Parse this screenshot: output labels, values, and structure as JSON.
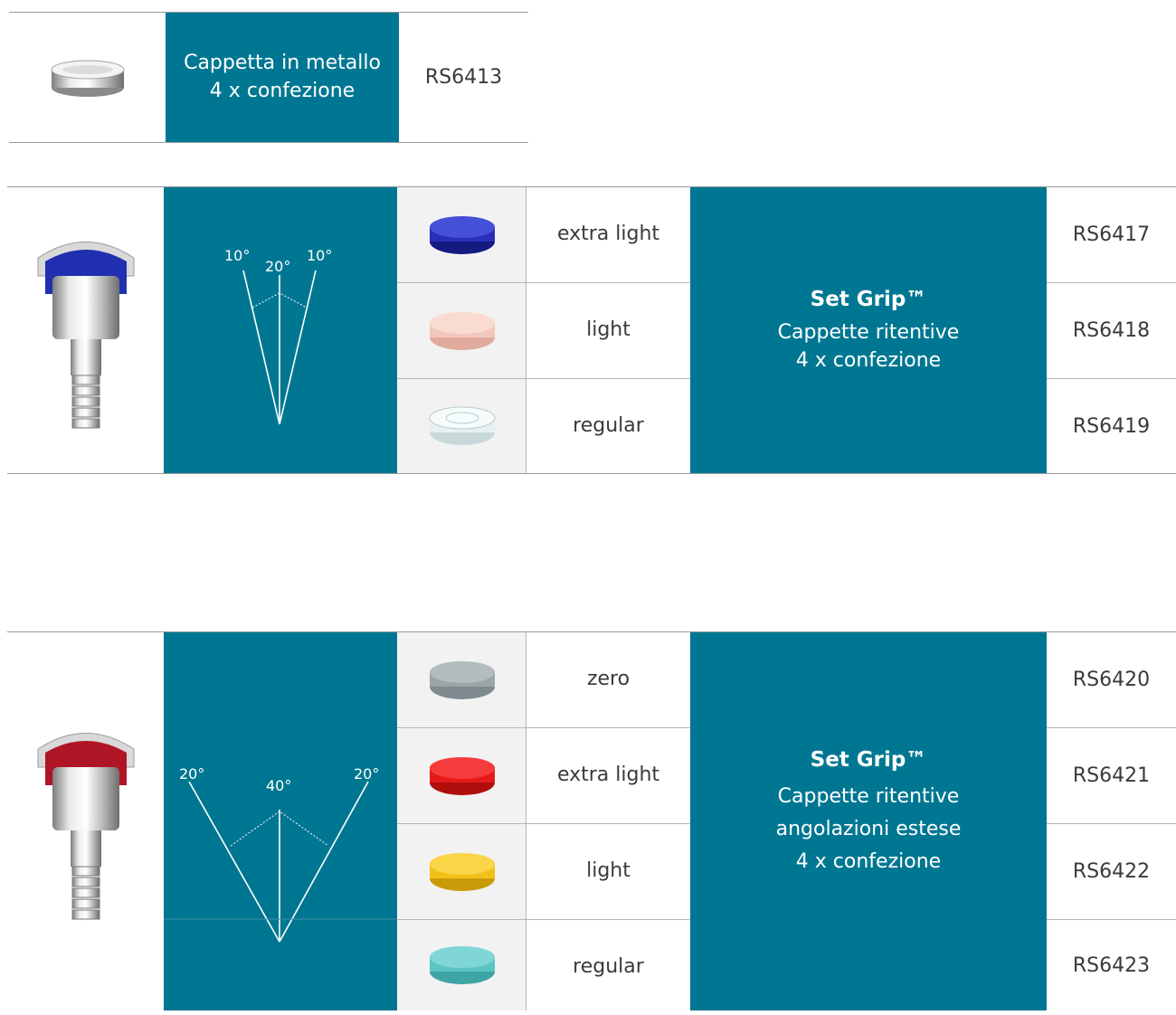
{
  "table1": {
    "product_label_line1": "Cappetta in metallo",
    "product_label_line2": "4 x confezione",
    "code": "RS6413"
  },
  "table2": {
    "angles": {
      "left": "10°",
      "center": "20°",
      "right": "10°"
    },
    "caps": [
      {
        "label": "extra light",
        "code": "RS6417",
        "color": "#2a2fb8"
      },
      {
        "label": "light",
        "code": "RS6418",
        "color": "#f3c8bc"
      },
      {
        "label": "regular",
        "code": "RS6419",
        "color": "#e6f0f0"
      }
    ],
    "title": "Set Grip™",
    "line1": "Cappette ritentive",
    "line2": "4 x confezione",
    "abutment_color": "#2030b0"
  },
  "table3": {
    "angles": {
      "left": "20°",
      "center": "40°",
      "right": "20°"
    },
    "caps": [
      {
        "label": "zero",
        "code": "RS6420",
        "color": "#9aa5a8"
      },
      {
        "label": "extra light",
        "code": "RS6421",
        "color": "#e41a1a"
      },
      {
        "label": "light",
        "code": "RS6422",
        "color": "#f2c019"
      },
      {
        "label": "regular",
        "code": "RS6423",
        "color": "#5cc4c4"
      }
    ],
    "title": "Set Grip™",
    "line1": "Cappette ritentive",
    "line2": "angolazioni estese",
    "line3": "4 x confezione",
    "abutment_color": "#b01525"
  }
}
